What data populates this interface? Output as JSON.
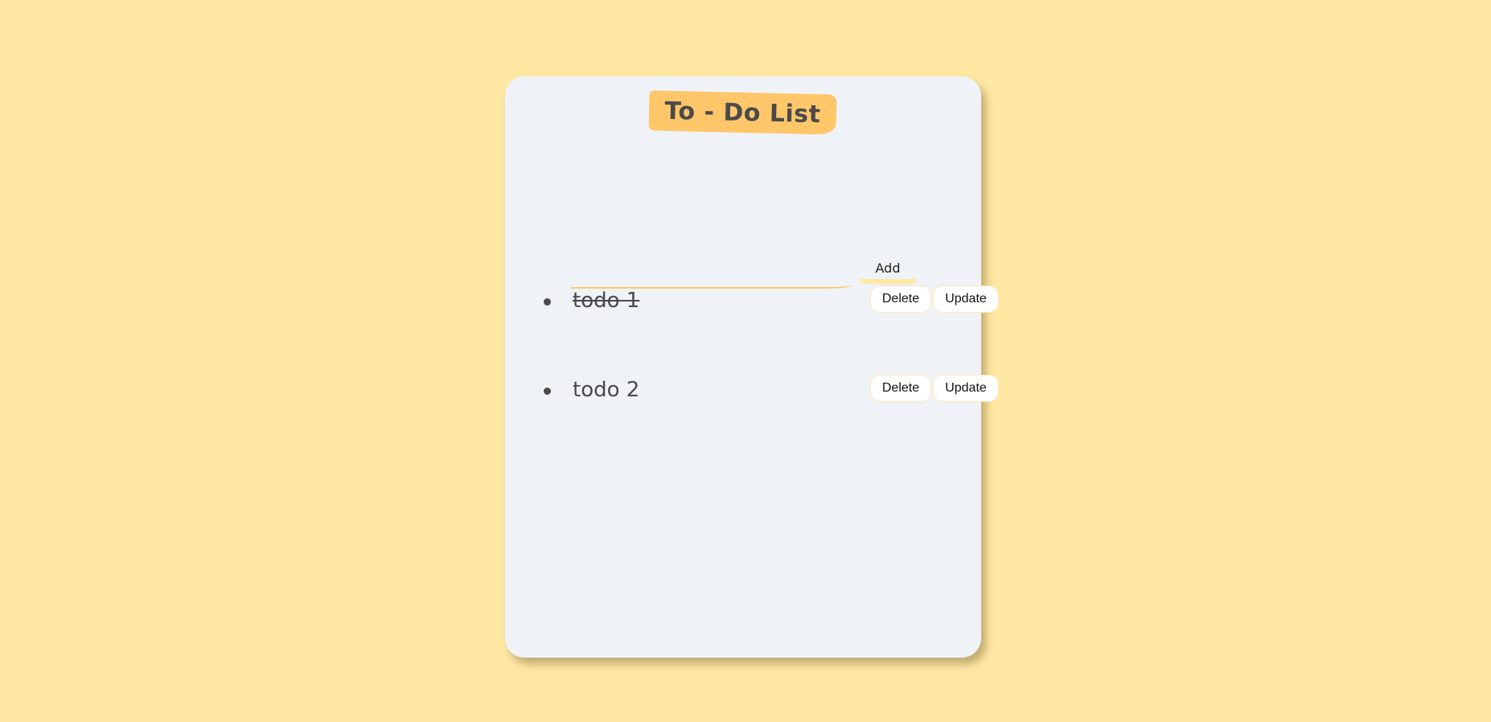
{
  "app": {
    "title": "To - Do List"
  },
  "form": {
    "input_value": "",
    "input_placeholder": "",
    "add_label": "Add"
  },
  "todos": [
    {
      "text": "todo 1",
      "completed": true,
      "delete_label": "Delete",
      "update_label": "Update"
    },
    {
      "text": "todo 2",
      "completed": false,
      "delete_label": "Delete",
      "update_label": "Update"
    }
  ],
  "colors": {
    "background": "#ffe8a3",
    "card": "#eff3f8",
    "accent": "#ffc769",
    "text": "#4a4a4a"
  }
}
